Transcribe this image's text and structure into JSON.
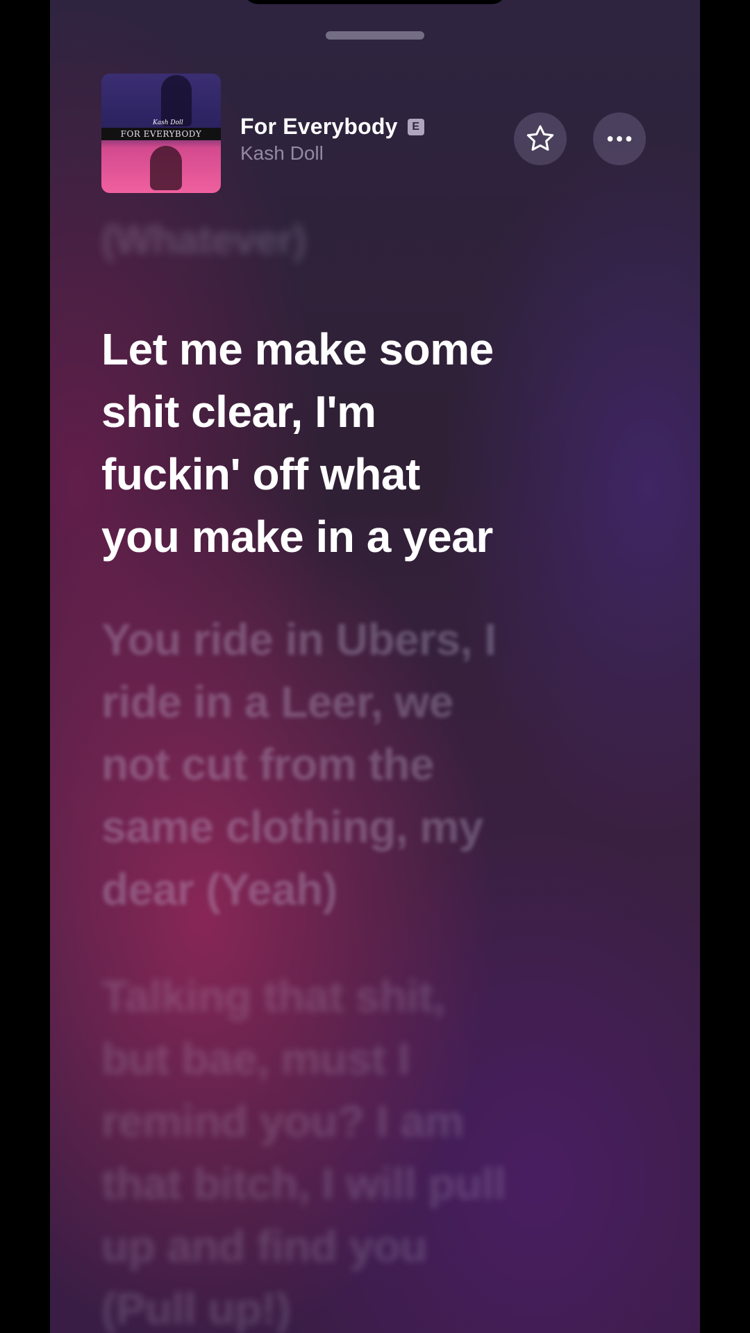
{
  "now_playing": {
    "title": "For Everybody",
    "explicit_badge": "E",
    "artist": "Kash Doll",
    "artwork_text": "FOR EVERYBODY",
    "artwork_signature": "Kash Doll"
  },
  "buttons": {
    "favorite_icon": "star-outline-icon",
    "more_icon": "ellipsis-icon"
  },
  "lyrics": {
    "previous_lines": [
      "(Whatever)"
    ],
    "current_lines": [
      "Let me make some",
      "shit clear, I'm",
      "fuckin' off what",
      "you make in a year"
    ],
    "next_lines": [
      "You ride in Ubers, I",
      "ride in a Leer, we",
      "not cut from the",
      "same clothing, my",
      "dear (Yeah)"
    ],
    "next2_lines": [
      "Talking that shit,",
      "but bae, must I",
      "remind you? I am",
      "that bitch, I will pull",
      "up and find you",
      "(Pull up!)"
    ]
  },
  "colors": {
    "background_top": "#2e2440",
    "background_accent": "#963c5a",
    "text_primary": "#ffffff"
  }
}
